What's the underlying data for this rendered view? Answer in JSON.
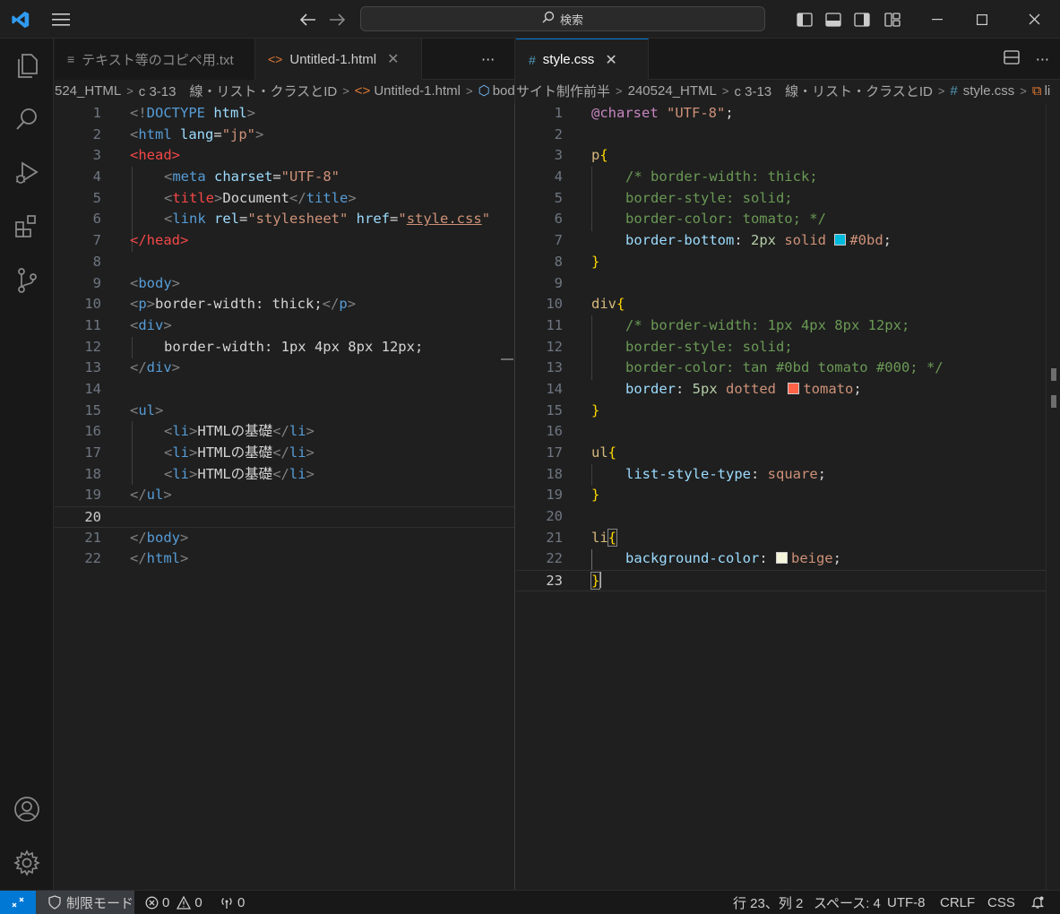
{
  "titlebar": {
    "search_label": "検索",
    "icons": [
      "vscode-logo-icon",
      "menu-icon",
      "back-arrow-icon",
      "forward-arrow-icon",
      "search-icon",
      "toggle-primary-sidebar-icon",
      "toggle-panel-icon",
      "toggle-secondary-sidebar-icon",
      "customize-layout-icon",
      "minimize-icon",
      "maximize-icon",
      "close-icon"
    ]
  },
  "activitybar": {
    "items": [
      "explorer-icon",
      "search-icon",
      "run-debug-icon",
      "extensions-icon",
      "source-control-icon"
    ],
    "bottom": [
      "accounts-icon",
      "settings-gear-icon"
    ]
  },
  "left_group": {
    "tabs": [
      {
        "label": "テキスト等のコピペ用.txt",
        "icon": "≡"
      },
      {
        "label": "Untitled-1.html",
        "icon": "<>"
      }
    ],
    "breadcrumb": [
      "524_HTML",
      "c 3-13　線・リスト・クラスとID",
      "Untitled-1.html",
      "body"
    ],
    "current_line": "20",
    "line_numbers": [
      "1",
      "2",
      "3",
      "4",
      "5",
      "6",
      "7",
      "8",
      "9",
      "10",
      "11",
      "12",
      "13",
      "14",
      "15",
      "16",
      "17",
      "18",
      "19",
      "20",
      "21",
      "22"
    ],
    "lines": {
      "l1a": "<!",
      "l1b": "DOCTYPE",
      "l1c": " html",
      "l1d": ">",
      "l2a": "<",
      "l2b": "html",
      "l2c": " lang",
      "l2d": "=",
      "l2e": "\"jp\"",
      "l2f": ">",
      "l3a": "<",
      "l3b": "head",
      "l3c": ">",
      "l4a": "<",
      "l4b": "meta",
      "l4c": " charset",
      "l4d": "=",
      "l4e": "\"UTF-8\"",
      "l5a": "<",
      "l5b": "title",
      "l5c": ">",
      "l5d": "Document",
      "l5e": "</",
      "l5f": "title",
      "l5g": ">",
      "l6a": "<",
      "l6b": "link",
      "l6c": " rel",
      "l6d": "=",
      "l6e": "\"stylesheet\"",
      "l6f": " href",
      "l6g": "=",
      "l6h": "\"",
      "l6i": "style.css",
      "l6j": "\"",
      "l7a": "</",
      "l7b": "head",
      "l7c": ">",
      "l9a": "<",
      "l9b": "body",
      "l9c": ">",
      "l10a": "<",
      "l10b": "p",
      "l10c": ">",
      "l10d": "border-width: thick;",
      "l10e": "</",
      "l10f": "p",
      "l10g": ">",
      "l11a": "<",
      "l11b": "div",
      "l11c": ">",
      "l12a": "border-width: 1px 4px 8px 12px;",
      "l13a": "</",
      "l13b": "div",
      "l13c": ">",
      "l15a": "<",
      "l15b": "ul",
      "l15c": ">",
      "li_open_a": "<",
      "li_tag": "li",
      "li_open_c": ">",
      "li_text": "HTMLの基礎",
      "li_close_a": "</",
      "li_close_c": ">",
      "l19a": "</",
      "l19b": "ul",
      "l19c": ">",
      "l21a": "</",
      "l21b": "body",
      "l21c": ">",
      "l22a": "</",
      "l22b": "html",
      "l22c": ">"
    }
  },
  "right_group": {
    "tab": {
      "label": "style.css",
      "icon": "#"
    },
    "breadcrumb": [
      "サイト制作前半",
      "240524_HTML",
      "c 3-13　線・リスト・クラスとID",
      "style.css",
      "li"
    ],
    "current_line": "23",
    "line_numbers": [
      "1",
      "2",
      "3",
      "4",
      "5",
      "6",
      "7",
      "8",
      "9",
      "10",
      "11",
      "12",
      "13",
      "14",
      "15",
      "16",
      "17",
      "18",
      "19",
      "20",
      "21",
      "22",
      "23"
    ],
    "lines": {
      "r1a": "@charset",
      "r1b": " \"UTF-8\"",
      "r1c": ";",
      "r3a": "p",
      "r3b": "{",
      "r4": "/* border-width: thick;",
      "r5": "border-style: solid;",
      "r6": "border-color: tomato; */",
      "r7a": "border-bottom",
      "r7b": ": ",
      "r7c": "2px",
      "r7d": " solid ",
      "r7e": "#0bd",
      "r7f": ";",
      "r8": "}",
      "r10a": "div",
      "r10b": "{",
      "r11": "/* border-width: 1px 4px 8px 12px;",
      "r12": "border-style: solid;",
      "r13": "border-color: tan #0bd tomato #000; */",
      "r14a": "border",
      "r14b": ": ",
      "r14c": "5px",
      "r14d": " dotted ",
      "r14e": "tomato",
      "r14f": ";",
      "r15": "}",
      "r17a": "ul",
      "r17b": "{",
      "r18a": "list-style-type",
      "r18b": ": ",
      "r18c": "square",
      "r18d": ";",
      "r19": "}",
      "r21a": "li",
      "r21b": "{",
      "r22a": "background-color",
      "r22b": ": ",
      "r22c": "beige",
      "r22d": ";",
      "r23": "}"
    },
    "swatch_colors": {
      "c0bd": "#00bbdd",
      "tomato": "#ff6347",
      "beige": "#f5f5dc"
    }
  },
  "statusbar": {
    "restricted_mode": "制限モード",
    "errors": "0",
    "warnings": "0",
    "ports": "0",
    "position": "行 23、列 2",
    "spaces": "スペース: 4",
    "encoding": "UTF-8",
    "eol": "CRLF",
    "language": "CSS"
  },
  "colors": {
    "accent": "#0078d4",
    "background": "#1f1f1f"
  }
}
